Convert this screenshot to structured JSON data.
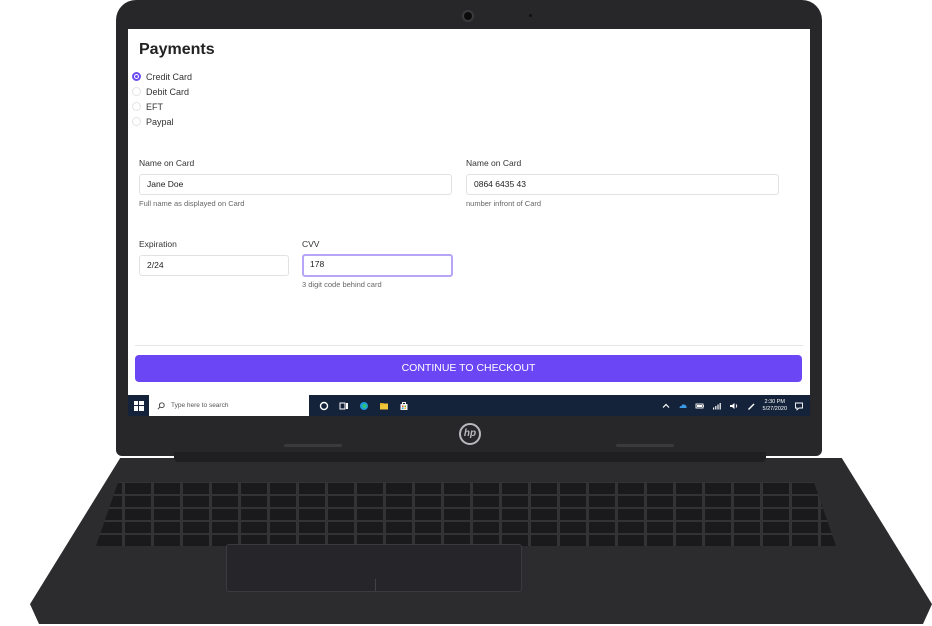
{
  "screen": {
    "title": "Payments",
    "payment_methods": [
      {
        "label": "Credit Card",
        "selected": true
      },
      {
        "label": "Debit Card",
        "selected": false
      },
      {
        "label": "EFT",
        "selected": false
      },
      {
        "label": "Paypal",
        "selected": false
      }
    ],
    "fields": {
      "name_on_card": {
        "label": "Name on Card",
        "value": "Jane Doe",
        "hint": "Full name as displayed on Card"
      },
      "card_number": {
        "label": "Name on Card",
        "value": "0864 6435 43",
        "hint": "number infront of Card"
      },
      "expiration": {
        "label": "Expiration",
        "value": "2/24"
      },
      "cvv": {
        "label": "CVV",
        "value": "178",
        "hint": "3 digit code behind card"
      }
    },
    "checkout_button": "CONTINUE TO CHECKOUT",
    "accent_color": "#6b46f5"
  },
  "taskbar": {
    "search_placeholder": "Type here to search",
    "time": "2:30 PM",
    "date": "5/27/2020",
    "pinned_icons": [
      "cortana-icon",
      "task-view-icon",
      "edge-icon",
      "file-explorer-icon",
      "store-icon"
    ],
    "tray_icons": [
      "chevron-up-icon",
      "onedrive-icon",
      "battery-icon",
      "network-icon",
      "volume-icon",
      "pen-icon",
      "notification-icon"
    ]
  },
  "device": {
    "logo": "hp"
  }
}
